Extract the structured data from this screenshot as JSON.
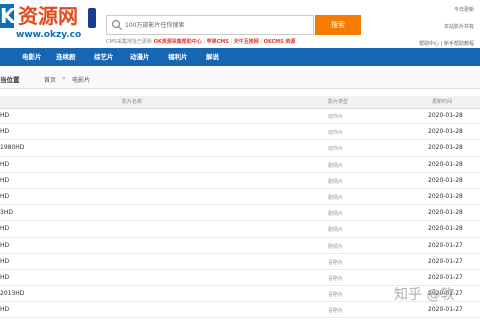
{
  "header": {
    "logo_k": "K",
    "logo_text": "资源网",
    "logo_url": "www.okzy.co",
    "search_placeholder": "100万部影片任你搜索",
    "search_button": "搜索",
    "notice": {
      "text1": "CMS采集地址已更新",
      "highlight1": "OK资源采集帮助中心",
      "text2": "|",
      "highlight2": "苹果CMS",
      "text3": "|",
      "highlight3": "天午互推网",
      "text4": "|",
      "highlight4": "OKCMS",
      "highlight5": "资源"
    },
    "topright": {
      "line1": "今日更新",
      "line2": "本站影片共有",
      "line3": "帮助中心 | 新手帮助教程"
    }
  },
  "nav": {
    "items": [
      "电影片",
      "连续剧",
      "综艺片",
      "动漫片",
      "福利片",
      "解说"
    ]
  },
  "breadcrumb": {
    "label": "当位置",
    "home": "首页",
    "arrow": "»",
    "current": "电影片"
  },
  "table": {
    "headers": [
      "影片名称",
      "影片类型",
      "更新时间"
    ],
    "rows": [
      {
        "title": "HD",
        "category": "动作片",
        "date": "2020-01-28"
      },
      {
        "title": "HD",
        "category": "动作片",
        "date": "2020-01-28"
      },
      {
        "title": "1980HD",
        "category": "动作片",
        "date": "2020-01-28"
      },
      {
        "title": "HD",
        "category": "剧情片",
        "date": "2020-01-28"
      },
      {
        "title": "HD",
        "category": "剧情片",
        "date": "2020-01-28"
      },
      {
        "title": "HD",
        "category": "剧情片",
        "date": "2020-01-28"
      },
      {
        "title": "3HD",
        "category": "剧情片",
        "date": "2020-01-28"
      },
      {
        "title": "HD",
        "category": "剧情片",
        "date": "2020-01-28"
      },
      {
        "title": "HD",
        "category": "剧情片",
        "date": "2020-01-27"
      },
      {
        "title": "HD",
        "category": "喜剧片",
        "date": "2020-01-27"
      },
      {
        "title": "HD",
        "category": "喜剧片",
        "date": "2020-01-27"
      },
      {
        "title": "2013HD",
        "category": "喜剧片",
        "date": "2020-01-27"
      },
      {
        "title": "HD",
        "category": "喜剧片",
        "date": "2020-01-27"
      }
    ]
  },
  "watermark": "知乎 @软",
  "colors": {
    "brand_blue": "#1567b3",
    "logo_red": "#e64a19",
    "search_orange": "#f57c00",
    "notice_red": "#e53935"
  }
}
